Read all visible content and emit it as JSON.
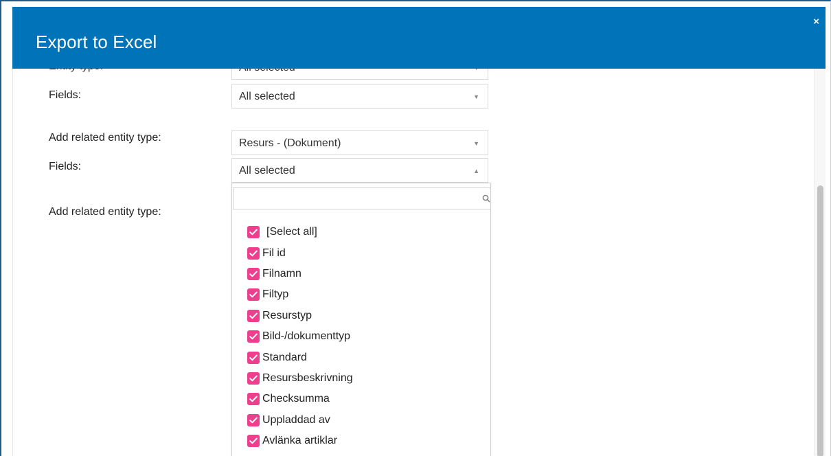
{
  "dialog": {
    "title": "Export to Excel",
    "close_glyph": "×"
  },
  "colors": {
    "header_bg": "#0173b8",
    "checkbox": "#ee3f8e"
  },
  "rows": [
    {
      "label": "Entity type:",
      "value": "All selected",
      "state": "collapsed"
    },
    {
      "label": "Fields:",
      "value": "All selected",
      "state": "collapsed"
    },
    {
      "label": "Add related entity type:",
      "value": "Resurs - (Dokument)",
      "state": "collapsed"
    },
    {
      "label": "Fields:",
      "value": "All selected",
      "state": "open"
    },
    {
      "label": "Add related entity type:",
      "value": "",
      "state": "collapsed"
    }
  ],
  "dropdown": {
    "search_placeholder": "",
    "options": [
      {
        "label": "[Select all]",
        "checked": true
      },
      {
        "label": "Fil id",
        "checked": true
      },
      {
        "label": "Filnamn",
        "checked": true
      },
      {
        "label": "Filtyp",
        "checked": true
      },
      {
        "label": "Resurstyp",
        "checked": true
      },
      {
        "label": "Bild-/dokumenttyp",
        "checked": true
      },
      {
        "label": "Standard",
        "checked": true
      },
      {
        "label": "Resursbeskrivning",
        "checked": true
      },
      {
        "label": "Checksumma",
        "checked": true
      },
      {
        "label": "Uppladdad av",
        "checked": true
      },
      {
        "label": "Avlänka artiklar",
        "checked": true
      }
    ]
  },
  "icons": {
    "close": "close-icon",
    "caret_down": "chevron-down-icon",
    "caret_up": "chevron-up-icon",
    "search": "search-icon",
    "check": "check-icon"
  }
}
